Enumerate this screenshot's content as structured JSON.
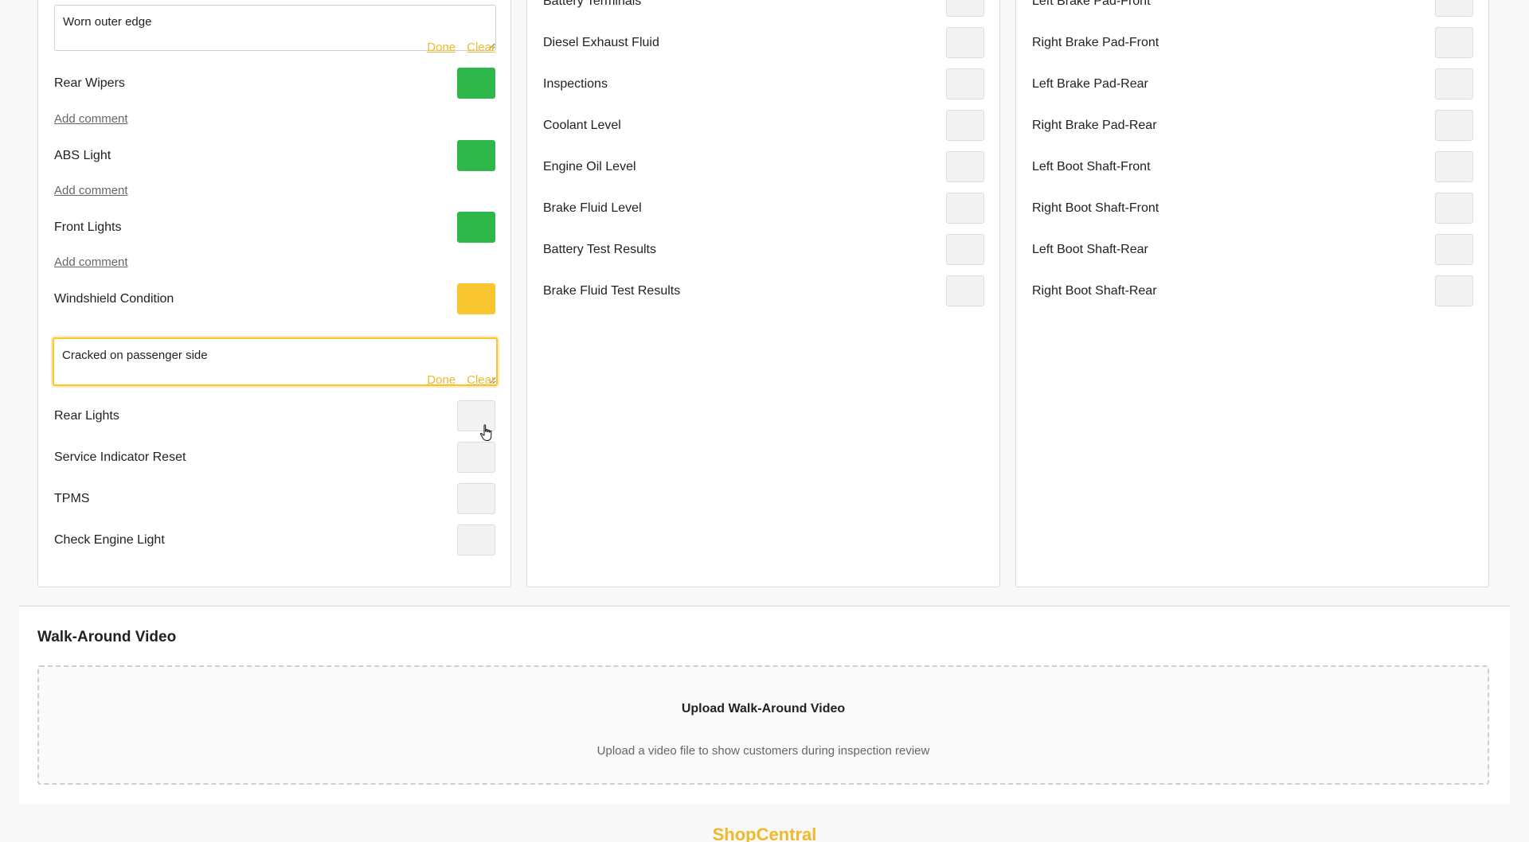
{
  "column1": {
    "comment_top": {
      "value": "Worn outer edge",
      "done": "Done",
      "clear": "Clear"
    },
    "items": [
      {
        "label": "Rear Wipers",
        "status": "green",
        "add_comment": "Add comment"
      },
      {
        "label": "ABS Light",
        "status": "green",
        "add_comment": "Add comment"
      },
      {
        "label": "Front Lights",
        "status": "green",
        "add_comment": "Add comment"
      },
      {
        "label": "Windshield Condition",
        "status": "yellow"
      }
    ],
    "comment_windshield": {
      "value": "Cracked on passenger side",
      "done": "Done",
      "clear": "Clear"
    },
    "items_after": [
      {
        "label": "Rear Lights",
        "status": "none"
      },
      {
        "label": "Service Indicator Reset",
        "status": "none"
      },
      {
        "label": "TPMS",
        "status": "none"
      },
      {
        "label": "Check Engine Light",
        "status": "none"
      }
    ]
  },
  "column2": {
    "items": [
      {
        "label": "Battery Terminals"
      },
      {
        "label": "Diesel Exhaust Fluid"
      },
      {
        "label": "Inspections"
      },
      {
        "label": "Coolant Level"
      },
      {
        "label": "Engine Oil Level"
      },
      {
        "label": "Brake Fluid Level"
      },
      {
        "label": "Battery Test Results"
      },
      {
        "label": "Brake Fluid Test Results"
      }
    ]
  },
  "column3": {
    "items": [
      {
        "label": "Left Brake Pad-Front"
      },
      {
        "label": "Right Brake Pad-Front"
      },
      {
        "label": "Left Brake Pad-Rear"
      },
      {
        "label": "Right Brake Pad-Rear"
      },
      {
        "label": "Left Boot Shaft-Front"
      },
      {
        "label": "Right Boot Shaft-Front"
      },
      {
        "label": "Left Boot Shaft-Rear"
      },
      {
        "label": "Right Boot Shaft-Rear"
      }
    ]
  },
  "video": {
    "title": "Walk-Around Video",
    "upload_title": "Upload Walk-Around Video",
    "upload_subtitle": "Upload a video file to show customers during inspection review"
  },
  "footer": {
    "brand": "ShopCentral"
  },
  "colors": {
    "green": "#2eb84b",
    "yellow": "#f8c630",
    "accent": "#f0b92c",
    "empty": "#f3f3f3"
  }
}
